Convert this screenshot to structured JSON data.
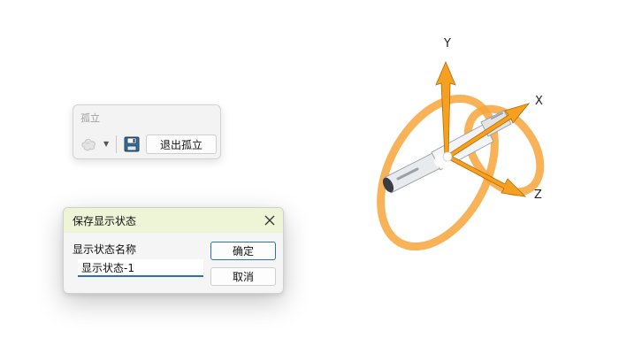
{
  "isolate_toolbar": {
    "title": "孤立",
    "display_style_icon": "display-style-icon",
    "dropdown_icon": "chevron-down-icon",
    "save_icon": "floppy-disk-icon",
    "exit_isolate_label": "退出孤立"
  },
  "save_display_state_dialog": {
    "title": "保存显示状态",
    "close_icon": "close-icon",
    "name_label": "显示状态名称",
    "name_value": "显示状态-1",
    "ok_label": "确定",
    "cancel_label": "取消"
  },
  "triad": {
    "x_label": "X",
    "y_label": "Y",
    "z_label": "Z",
    "axis_color": "#f5a020",
    "ring_color": "#f7a43a"
  },
  "colors": {
    "dialog_titlebar": "#eef5d6",
    "accent": "#2e6fb6"
  }
}
